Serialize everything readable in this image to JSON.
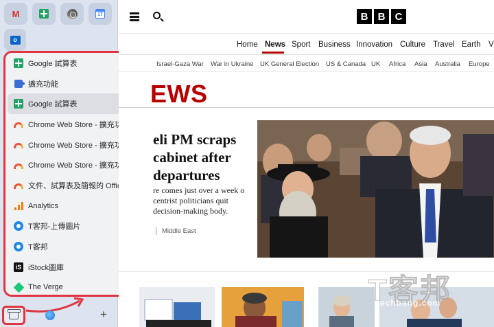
{
  "sidebar": {
    "pinned": [
      {
        "icon": "gmail-icon",
        "glyph": "M"
      },
      {
        "icon": "google-sheets-icon"
      },
      {
        "icon": "chrome-web-store-icon"
      },
      {
        "icon": "google-calendar-icon",
        "glyph": "17"
      },
      {
        "icon": "outlook-icon",
        "glyph": "o"
      }
    ],
    "tabs": [
      {
        "label": "Google 試算表",
        "icon": "google-sheets-icon"
      },
      {
        "label": "擴充功能",
        "icon": "extension-puzzle-icon"
      },
      {
        "label": "Google 試算表",
        "icon": "google-sheets-icon",
        "active": true,
        "close": "×"
      },
      {
        "label": "Chrome Web Store - 擴充功能",
        "icon": "chrome-web-store-icon"
      },
      {
        "label": "Chrome Web Store - 擴充功能",
        "icon": "chrome-web-store-icon"
      },
      {
        "label": "Chrome Web Store - 擴充功能",
        "icon": "chrome-web-store-icon"
      },
      {
        "label": "文件、試算表及簡報的 Office 編輯...",
        "icon": "chrome-web-store-icon"
      },
      {
        "label": "Analytics",
        "icon": "analytics-icon"
      },
      {
        "label": "T客邦-上傳圖片",
        "icon": "techbang-icon"
      },
      {
        "label": "T客邦",
        "icon": "techbang-icon"
      },
      {
        "label": "iStock圖庫",
        "icon": "istock-icon"
      },
      {
        "label": "The Verge",
        "icon": "the-verge-icon"
      }
    ],
    "footer": {
      "plus": "+"
    }
  },
  "bbc": {
    "logo": [
      "B",
      "B",
      "C"
    ],
    "nav": [
      "Home",
      "News",
      "Sport",
      "Business",
      "Innovation",
      "Culture",
      "Travel",
      "Earth",
      "V"
    ],
    "active_nav": "News",
    "subnav": [
      "Israel-Gaza War",
      "War in Ukraine",
      "UK General Election",
      "US & Canada",
      "UK",
      "Africa",
      "Asia",
      "Australia",
      "Europe"
    ],
    "section_heading": "EWS",
    "headline": "eli PM scraps cabinet after departures",
    "summary": "re comes just over a week o centrist politicians quit decision-making body.",
    "tag": "Middle East"
  },
  "watermark": {
    "text": "T客邦",
    "sub": "techbang.com"
  },
  "colors": {
    "bbc_red": "#b80000",
    "highlight": "#e23340",
    "sidebar_bg": "#dde3ef"
  }
}
